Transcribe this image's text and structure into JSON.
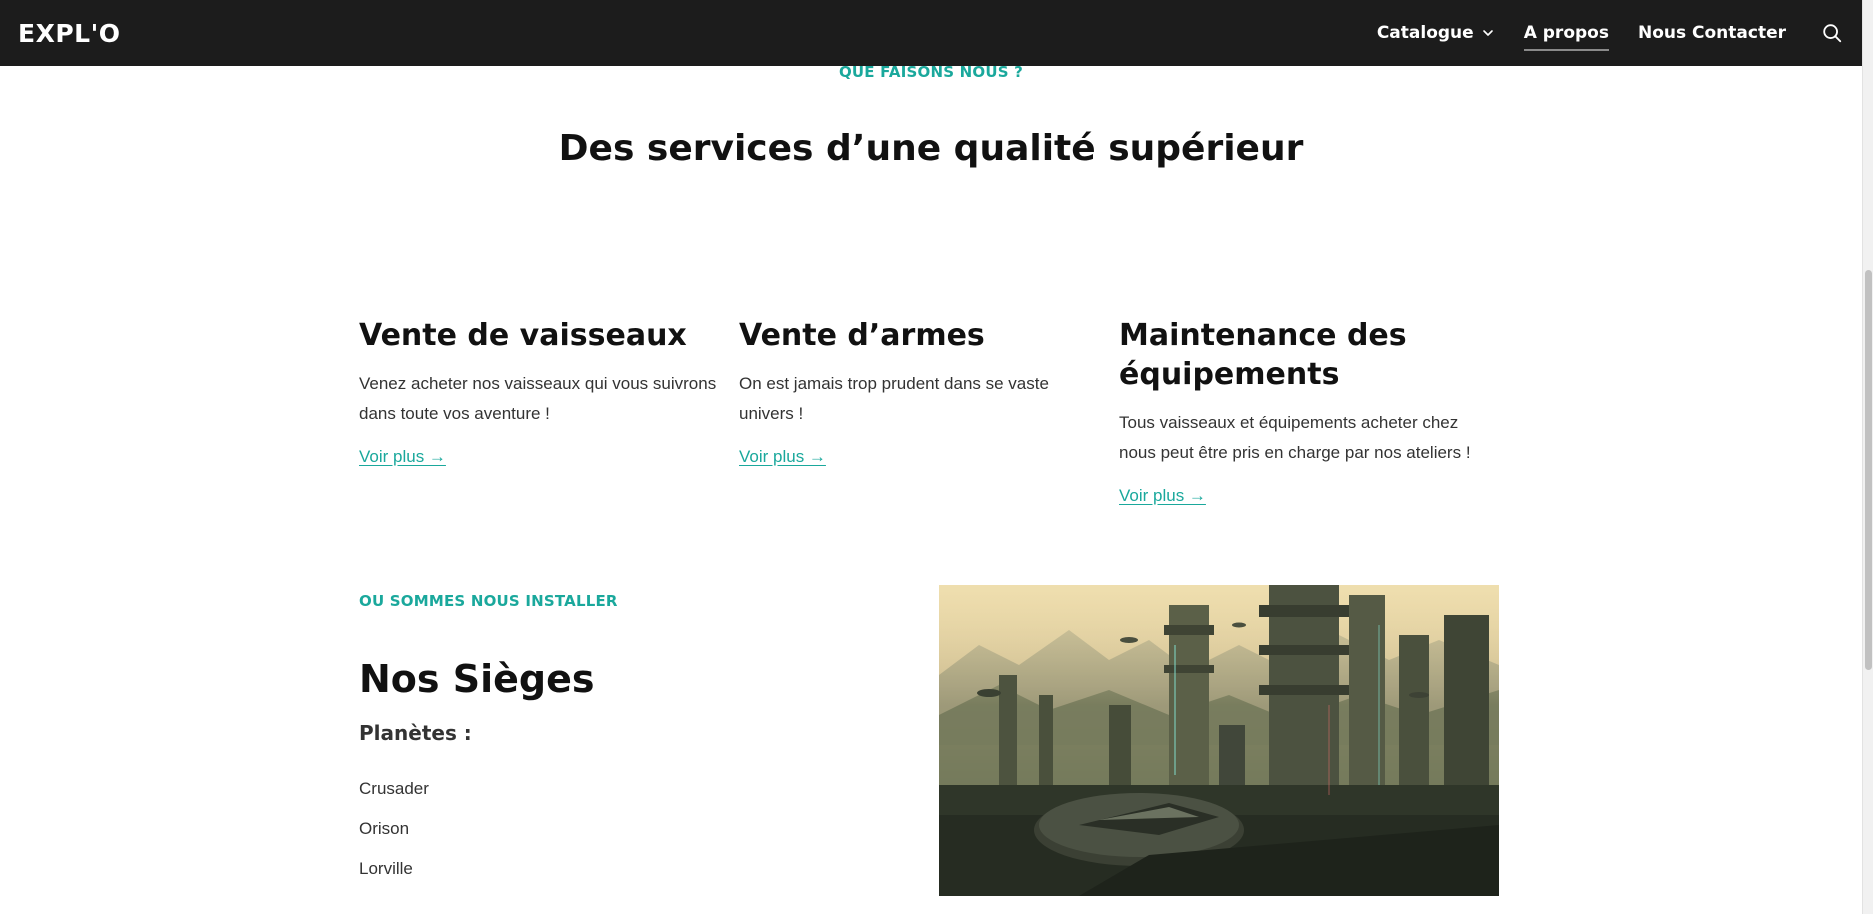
{
  "header": {
    "logo": "EXPL'O",
    "nav": [
      {
        "label": "Catalogue",
        "has_dropdown": true
      },
      {
        "label": "A propos",
        "active": true
      },
      {
        "label": "Nous Contacter"
      }
    ],
    "search_icon": "search-icon"
  },
  "services_section": {
    "eyebrow": "QUE FAISONS NOUS ?",
    "title": "Des services d’une qualité supérieur",
    "items": [
      {
        "title": "Vente de vaisseaux",
        "description": "Venez acheter nos vaisseaux qui vous suivrons dans toute vos aventure !",
        "link": "Voir plus →"
      },
      {
        "title": "Vente d’armes",
        "description": "On est jamais trop prudent dans se vaste univers !",
        "link": "Voir plus →"
      },
      {
        "title": "Maintenance des équipements",
        "description": "Tous vaisseaux et équipements acheter chez nous peut être pris en charge par nos ateliers !",
        "link": "Voir plus →"
      }
    ]
  },
  "sieges_section": {
    "eyebrow": "OU SOMMES NOUS INSTALLER",
    "title": "Nos Sièges",
    "planets_label": "Planètes :",
    "planets": [
      "Crusader",
      "Orison",
      "Lorville"
    ]
  },
  "colors": {
    "accent": "#1aa89c",
    "header_bg": "#1c1c1c",
    "text": "#111111"
  }
}
